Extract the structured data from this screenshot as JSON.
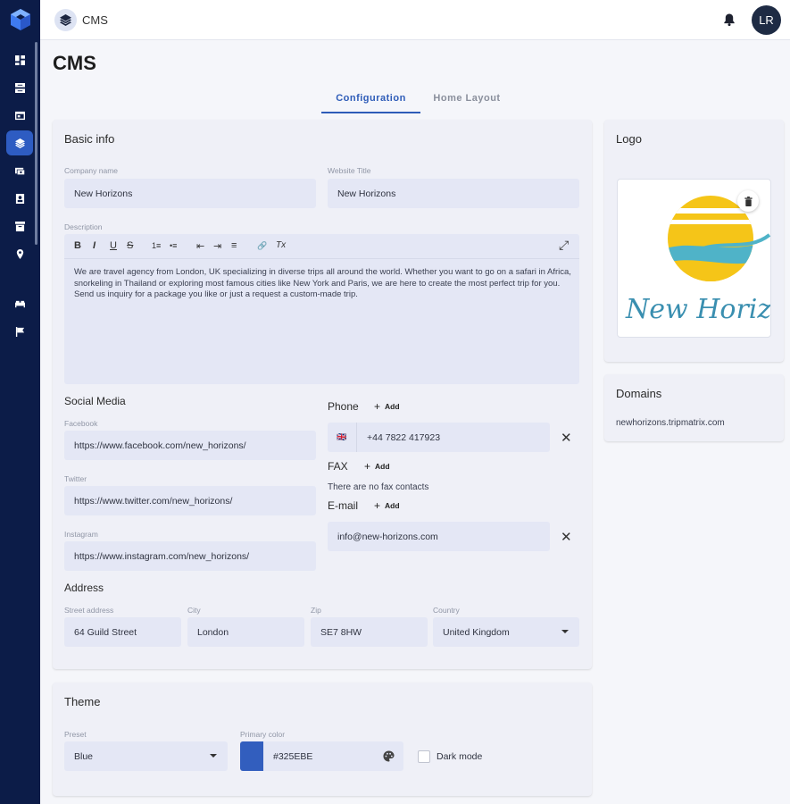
{
  "app": {
    "title": "CMS",
    "user_initials": "LR"
  },
  "page": {
    "title": "CMS"
  },
  "tabs": [
    {
      "label": "Configuration"
    },
    {
      "label": "Home Layout"
    }
  ],
  "sidebar": {
    "items": [
      {
        "icon": "dashboard-icon"
      },
      {
        "icon": "inbox-icon"
      },
      {
        "icon": "calendar-icon"
      },
      {
        "icon": "layers-icon",
        "active": true
      },
      {
        "icon": "payments-icon"
      },
      {
        "icon": "contacts-icon"
      },
      {
        "icon": "archive-icon"
      },
      {
        "icon": "location-icon"
      },
      {
        "icon": "bed-icon"
      },
      {
        "icon": "flag-icon"
      }
    ]
  },
  "basic_info": {
    "title": "Basic info",
    "company_name_label": "Company name",
    "company_name": "New Horizons",
    "website_title_label": "Website Title",
    "website_title": "New Horizons",
    "description_label": "Description",
    "description": "We are travel agency from London, UK specializing in diverse trips all around the world. Whether you want to go on a safari in Africa, snorkeling in Thailand or exploring most famous cities like New York and Paris, we are here to create the most perfect trip for you. Send us inquiry for a package you like or just a request a custom-made trip.",
    "toolbar": {
      "bold": "B",
      "italic": "I",
      "underline": "U",
      "strike": "S",
      "ordered_list": "1≡",
      "bullet_list": "•≡",
      "outdent": "⇤",
      "indent": "⇥",
      "align": "≡",
      "link": "🔗",
      "clear_format": "Tx",
      "fullscreen": "⤢"
    }
  },
  "social": {
    "title": "Social Media",
    "facebook_label": "Facebook",
    "facebook": "https://www.facebook.com/new_horizons/",
    "twitter_label": "Twitter",
    "twitter": "https://www.twitter.com/new_horizons/",
    "instagram_label": "Instagram",
    "instagram": "https://www.instagram.com/new_horizons/"
  },
  "contacts": {
    "phone_title": "Phone",
    "add_label": "Add",
    "phone_flag": "🇬🇧",
    "phone_value": "+44 7822 417923",
    "fax_title": "FAX",
    "fax_empty": "There are no fax contacts",
    "email_title": "E-mail",
    "email_value": "info@new-horizons.com"
  },
  "address": {
    "title": "Address",
    "street_label": "Street address",
    "street": "64 Guild Street",
    "city_label": "City",
    "city": "London",
    "zip_label": "Zip",
    "zip": "SE7 8HW",
    "country_label": "Country",
    "country": "United Kingdom"
  },
  "theme": {
    "title": "Theme",
    "preset_label": "Preset",
    "preset": "Blue",
    "primary_color_label": "Primary color",
    "primary_color": "#325EBE",
    "dark_mode_label": "Dark mode",
    "dark_mode": false
  },
  "logo": {
    "title": "Logo",
    "brand_text": "New Horizons"
  },
  "domains": {
    "title": "Domains",
    "value": "newhorizons.tripmatrix.com"
  },
  "colors": {
    "sidebar": "#0c1c48",
    "accent": "#2e5cb8",
    "field": "#e4e7f5",
    "card": "#eff0f7"
  }
}
